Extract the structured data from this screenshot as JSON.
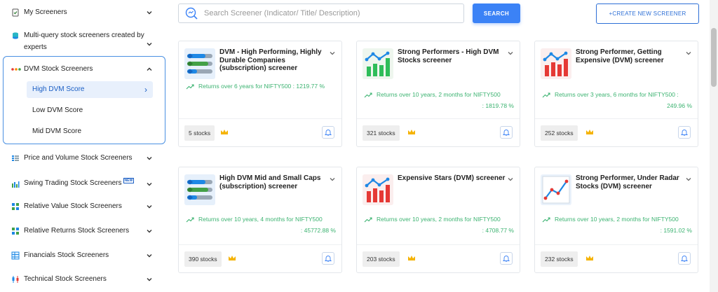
{
  "sidebar": {
    "items": [
      {
        "label": "My Screeners"
      },
      {
        "label": "Multi-query stock screeners created by experts"
      },
      {
        "label": "DVM Stock Screeners",
        "sub": [
          {
            "label": "High DVM Score"
          },
          {
            "label": "Low DVM Score"
          },
          {
            "label": "Mid DVM Score"
          }
        ]
      },
      {
        "label": "Price and Volume Stock Screeners"
      },
      {
        "label": "Swing Trading Stock Screeners",
        "badge": "NEW"
      },
      {
        "label": "Relative Value Stock Screeners"
      },
      {
        "label": "Relative Returns Stock Screeners"
      },
      {
        "label": "Financials Stock Screeners"
      },
      {
        "label": "Technical Stock Screeners"
      }
    ]
  },
  "search": {
    "placeholder": "Search Screener (Indicator/ Title/ Description)",
    "button_label": "SEARCH",
    "create_label": "+CREATE NEW SCREENER"
  },
  "cards": [
    {
      "title": "DVM - High Performing, Highly Durable Companies (subscription) screener",
      "returns_label": "Returns over 6 years for NIFTY500 :",
      "returns_value": "1219.77 %",
      "stocks": "5 stocks"
    },
    {
      "title": "Strong Performers - High DVM Stocks screener",
      "returns_label": "Returns over 10 years, 2 months for NIFTY500",
      "returns_value": ": 1819.78 %",
      "stocks": "321 stocks"
    },
    {
      "title": "Strong Performer, Getting Expensive (DVM) screener",
      "returns_label": "Returns over 3 years, 6 months for NIFTY500 :",
      "returns_value": "249.96 %",
      "stocks": "252 stocks"
    },
    {
      "title": "High DVM Mid and Small Caps (subscription) screener",
      "returns_label": "Returns over 10 years, 4 months for NIFTY500",
      "returns_value": ": 45772.88 %",
      "stocks": "390 stocks"
    },
    {
      "title": "Expensive Stars (DVM) screener",
      "returns_label": "Returns over 10 years, 2 months for NIFTY500",
      "returns_value": ": 4708.77 %",
      "stocks": "203 stocks"
    },
    {
      "title": "Strong Performer, Under Radar Stocks (DVM) screener",
      "returns_label": "Returns over 10 years, 2 months for NIFTY500",
      "returns_value": ": 1591.02 %",
      "stocks": "232 stocks"
    }
  ],
  "colors": {
    "accent": "#3b82f6",
    "positive": "#3cb371",
    "crown": "#f5b301",
    "active_bg": "#e8f0fc"
  }
}
